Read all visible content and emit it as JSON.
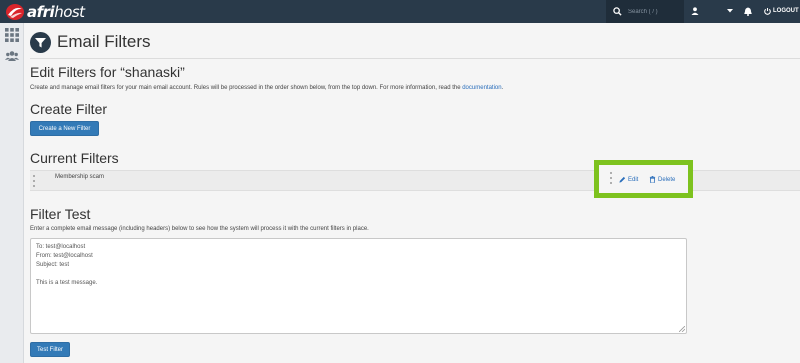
{
  "topbar": {
    "brand_bold": "afri",
    "brand_light": "host",
    "search_placeholder": "Search ( / )",
    "logout_label": "LOGOUT"
  },
  "page": {
    "title": "Email Filters",
    "edit_heading": "Edit Filters for “shanaski”",
    "intro_text": "Create and manage email filters for your main email account. Rules will be processed in the order shown below, from the top down. For more information, read the ",
    "intro_link": "documentation",
    "intro_end": "."
  },
  "create": {
    "heading": "Create Filter",
    "button_label": "Create a New Filter"
  },
  "current": {
    "heading": "Current Filters",
    "filters": [
      {
        "name": "Membership scam",
        "edit_label": "Edit",
        "delete_label": "Delete"
      }
    ]
  },
  "test": {
    "heading": "Filter Test",
    "description": "Enter a complete email message (including headers) below to see how the system will process it with the current filters in place.",
    "message": "To: test@localhost\nFrom: test@localhost\nSubject: test\n\nThis is a test message.",
    "button_label": "Test Filter"
  },
  "colors": {
    "topbar": "#293a4a",
    "primary_button": "#337ab7",
    "link": "#2a6ebb",
    "highlight": "#7dc21e"
  },
  "icons": [
    "afrihost-logo",
    "search-icon",
    "user-icon",
    "caret-down-icon",
    "bell-icon",
    "logout-icon",
    "apps-grid-icon",
    "users-icon",
    "filter-icon",
    "drag-handle-icon",
    "pencil-icon",
    "trash-icon",
    "resize-handle-icon"
  ]
}
